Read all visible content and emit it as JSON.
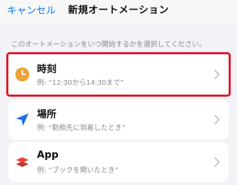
{
  "nav": {
    "cancel_label": "キャンセル",
    "title": "新規オートメーション"
  },
  "description": "このオートメーションをいつ開始するかを選択してください。",
  "triggers": [
    {
      "title": "時刻",
      "subtitle": "例: “12:30から14:30まで”",
      "icon": "clock-icon",
      "icon_color": "#f0a236",
      "selected": true
    },
    {
      "title": "場所",
      "subtitle": "例: “勤務先に到着したとき”",
      "icon": "location-arrow-icon",
      "icon_color": "#1a73e8",
      "selected": false
    },
    {
      "title": "App",
      "subtitle": "例: “ブックを開いたとき”",
      "icon": "app-stack-icon",
      "icon_color": "#e8453c",
      "selected": false
    }
  ],
  "colors": {
    "accent": "#007aff",
    "selection_outline": "#e0172a",
    "background": "#f2f2f7"
  }
}
